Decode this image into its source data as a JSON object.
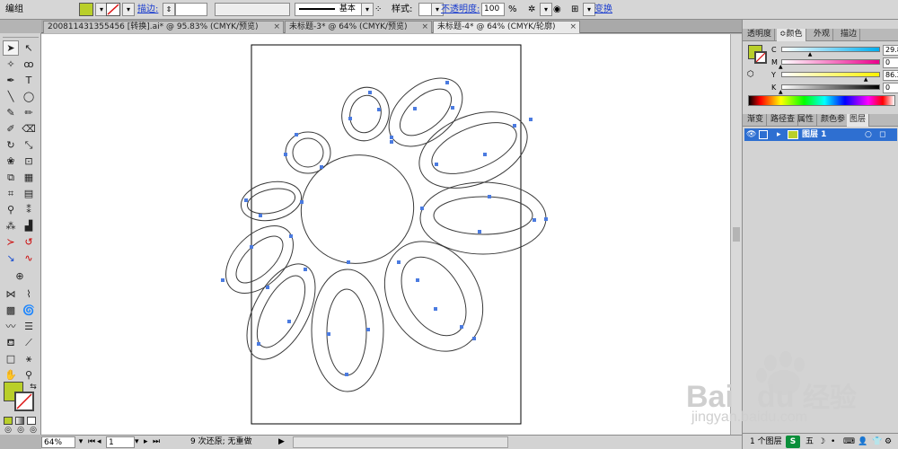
{
  "toolbar": {
    "group_label": "编组",
    "stroke_label": "描边:",
    "stroke_profile_label": "基本",
    "style_label": "样式:",
    "opacity_label": "不透明度:",
    "opacity_value": "100",
    "percent": "%",
    "transform_label": "变换",
    "fill_color": "#b9cf2a"
  },
  "doc_tabs": [
    {
      "label": "200811431355456  [转换].ai* @ 95.83% (CMYK/预览)",
      "close": "×"
    },
    {
      "label": "未标题-3* @ 64% (CMYK/预览)",
      "close": "×"
    },
    {
      "label": "未标题-4* @ 64% (CMYK/轮廓)",
      "close": "×"
    }
  ],
  "status": {
    "zoom": "64%",
    "page": "1",
    "message": "9 次还原; 无重做"
  },
  "panels": {
    "top_tabs": [
      "透明度",
      "≎颜色",
      "外观",
      "描边"
    ],
    "color": {
      "rows": [
        {
          "label": "C",
          "value": "29.8",
          "unit": "%",
          "gradient": "linear-gradient(to right,#fff,#00aeef)"
        },
        {
          "label": "M",
          "value": "0",
          "unit": "%",
          "gradient": "linear-gradient(to right,#fff,#ec008c)"
        },
        {
          "label": "Y",
          "value": "86.27",
          "unit": "%",
          "gradient": "linear-gradient(to right,#fff,#fff200)"
        },
        {
          "label": "K",
          "value": "0",
          "unit": "%",
          "gradient": "linear-gradient(to right,#fff,#000)"
        }
      ]
    },
    "bottom_tabs": [
      "渐变",
      "路径查",
      "属性",
      "颜色参",
      "图层"
    ],
    "layer": {
      "name": "图层 1"
    },
    "layers_count": "1 个图层"
  },
  "watermark": {
    "brand": "Bai",
    "brand_suffix": "du",
    "site_cn": "经验",
    "url": "jingyan.baidu.com"
  }
}
